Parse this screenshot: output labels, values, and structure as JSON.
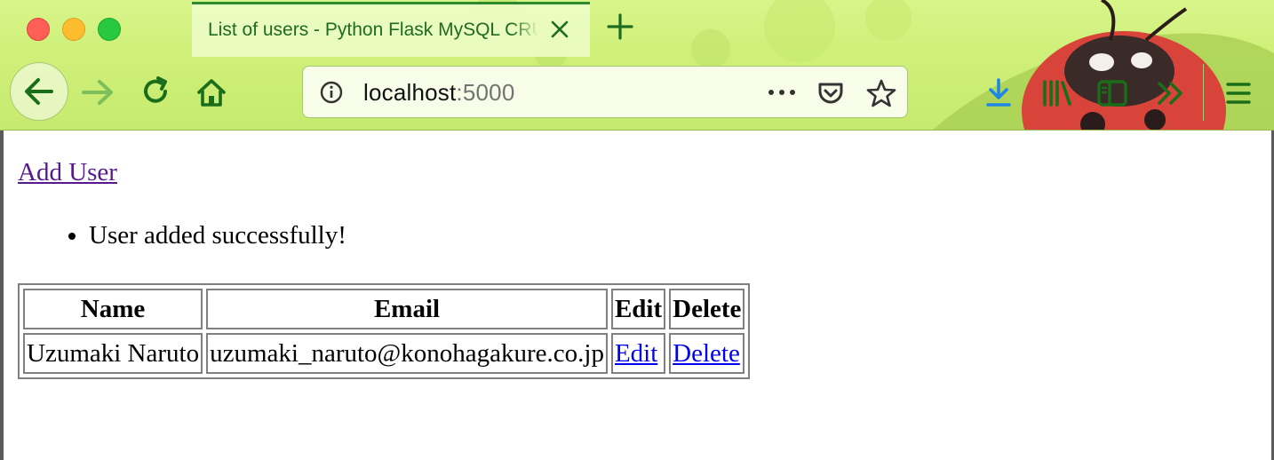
{
  "browser": {
    "tab_title": "List of users - Python Flask MySQL CRUD",
    "url_host": "localhost",
    "url_port": ":5000",
    "accent_color": "#2d8b2d",
    "theme_color": "#cff07a"
  },
  "icons": {
    "back": "arrow-left-icon",
    "forward": "arrow-right-icon",
    "reload": "reload-icon",
    "home": "home-icon",
    "info": "info-icon",
    "page_actions": "more-horizontal-icon",
    "pocket": "pocket-icon",
    "bookmark": "star-icon",
    "downloads": "download-icon",
    "library": "library-icon",
    "sidebar": "sidebar-icon",
    "overflow": "chevron-double-right-icon",
    "menu": "hamburger-menu-icon"
  },
  "page": {
    "add_user_link": "Add User",
    "flash_messages": [
      "User added successfully!"
    ],
    "table": {
      "headers": [
        "Name",
        "Email",
        "Edit",
        "Delete"
      ],
      "rows": [
        {
          "name": "Uzumaki Naruto",
          "email": "uzumaki_naruto@konohagakure.co.jp",
          "edit": "Edit",
          "delete": "Delete"
        }
      ]
    }
  }
}
